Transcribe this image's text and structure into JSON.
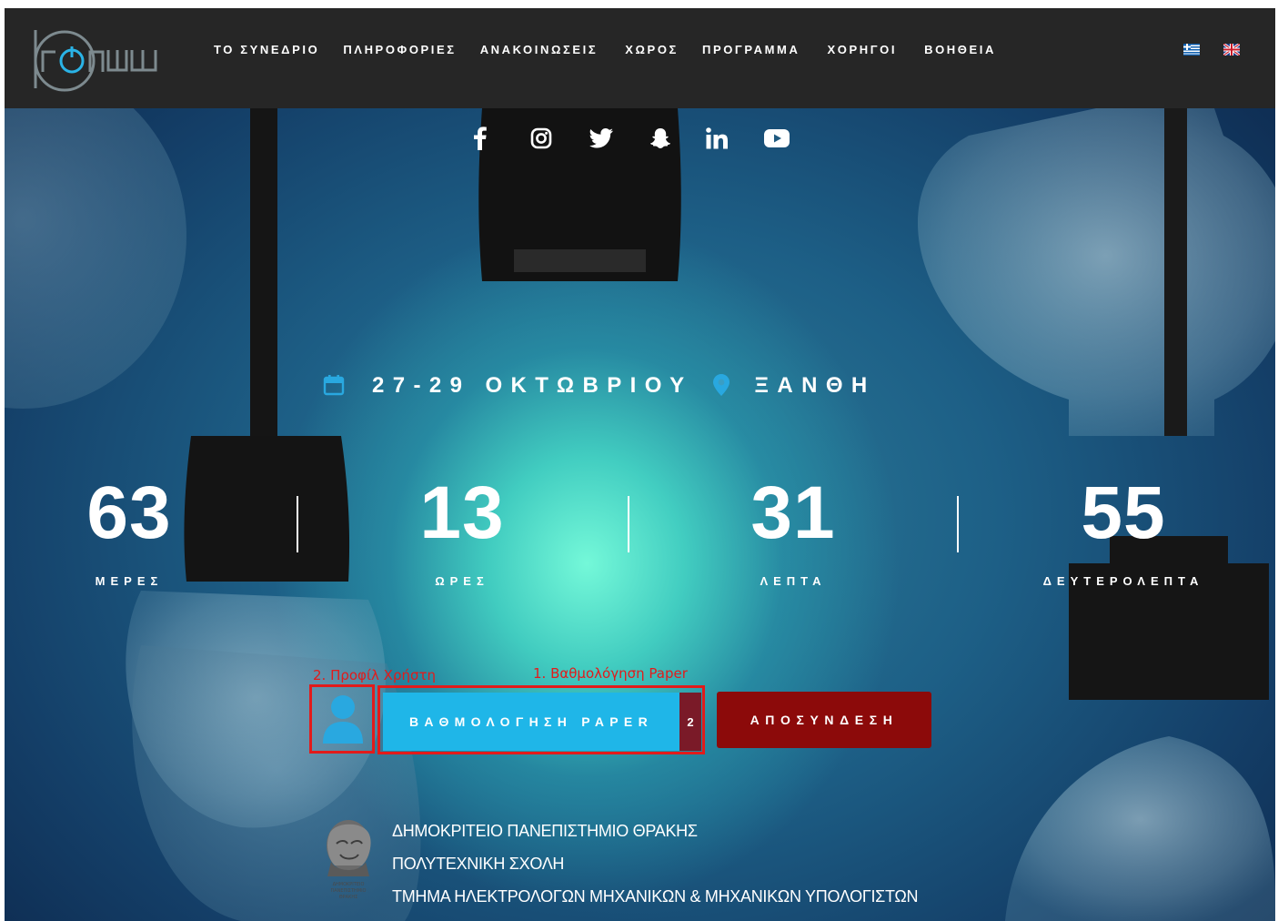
{
  "nav": {
    "items": [
      {
        "label": "ΤΟ ΣΥΝΕΔΡΙΟ"
      },
      {
        "label": "ΠΛΗΡΟΦΟΡΙΕΣ"
      },
      {
        "label": "ΑΝΑΚΟΙΝΩΣΕΙΣ"
      },
      {
        "label": "ΧΩΡΟΣ"
      },
      {
        "label": "ΠΡΟΓΡΑΜΜΑ"
      },
      {
        "label": "ΧΟΡΗΓΟΙ"
      },
      {
        "label": "ΒΟΗΘΕΙΑ"
      }
    ],
    "languages": [
      "greek-flag-icon",
      "uk-flag-icon"
    ]
  },
  "social": [
    "facebook-icon",
    "instagram-icon",
    "twitter-icon",
    "snapchat-icon",
    "linkedin-icon",
    "youtube-icon"
  ],
  "event": {
    "dates": "27-29 ΟΚΤΩΒΡΙΟΥ",
    "location": "ΞΑΝΘΗ"
  },
  "countdown": {
    "days": {
      "value": "63",
      "label": "ΜΕΡΕΣ"
    },
    "hours": {
      "value": "13",
      "label": "ΩΡΕΣ"
    },
    "minutes": {
      "value": "31",
      "label": "ΛΕΠΤΑ"
    },
    "seconds": {
      "value": "55",
      "label": "ΔΕΥΤΕΡΟΛΕΠΤΑ"
    }
  },
  "annotations": {
    "profile": "2. Προφίλ Χρήστη",
    "grading": "1. Βαθμολόγηση Paper"
  },
  "actions": {
    "grading_label": "ΒΑΘΜΟΛΟΓΗΣΗ PAPER",
    "grading_badge": "2",
    "logout_label": "ΑΠΟΣΥΝΔΕΣΗ"
  },
  "university": {
    "line1": "ΔΗΜΟΚΡΙΤΕΙΟ ΠΑΝΕΠΙΣΤΗΜΙΟ ΘΡΑΚΗΣ",
    "line2": "ΠΟΛΥΤΕΧΝΙΚΗ ΣΧΟΛΗ",
    "line3": "ΤΜΗΜΑ ΗΛΕΚΤΡΟΛΟΓΩΝ ΜΗΧΑΝΙΚΩΝ & ΜΗΧΑΝΙΚΩΝ ΥΠΟΛΟΓΙΣΤΩΝ",
    "seal_text": "ΔΗΜΟΚΡΙΤΕΙΟ ΠΑΝΕΠΙΣΤΗΜΙΟ ΘΡΑΚΗΣ"
  },
  "colors": {
    "navbar": "#262626",
    "accent_blue": "#1fb6e8",
    "logout_red": "#8c0a0a",
    "annotation_red": "#e21b1b",
    "icon_blue": "#29a8e0"
  }
}
